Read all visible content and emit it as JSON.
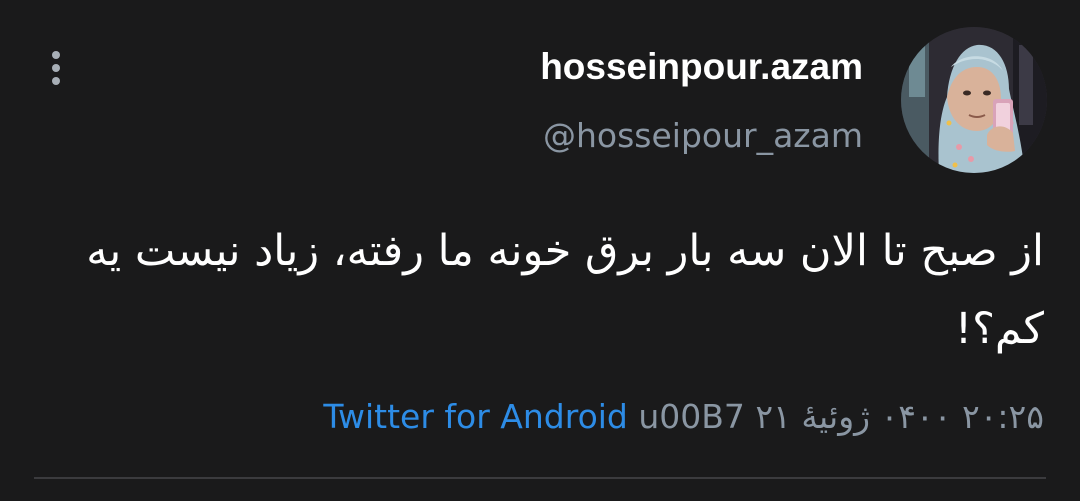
{
  "tweet": {
    "display_name": "hosseinpour.azam",
    "handle": "@hosseipour_azam",
    "text": "از صبح تا الان سه بار برق خونه ما رفته، زیاد نیست یه کم؟!",
    "timestamp": "۲۰:۲۵ ۰۴۰۰ ژوئیهٔ ۲۱",
    "separator": "u00B7",
    "source": "Twitter for Android"
  },
  "icons": {
    "more": "more-vertical-icon",
    "avatar": "profile-photo"
  },
  "colors": {
    "background": "#1a1a1b",
    "text_primary": "#ffffff",
    "text_secondary": "#8a96a3",
    "link": "#2d8ce6",
    "divider": "#3b3b3e"
  }
}
